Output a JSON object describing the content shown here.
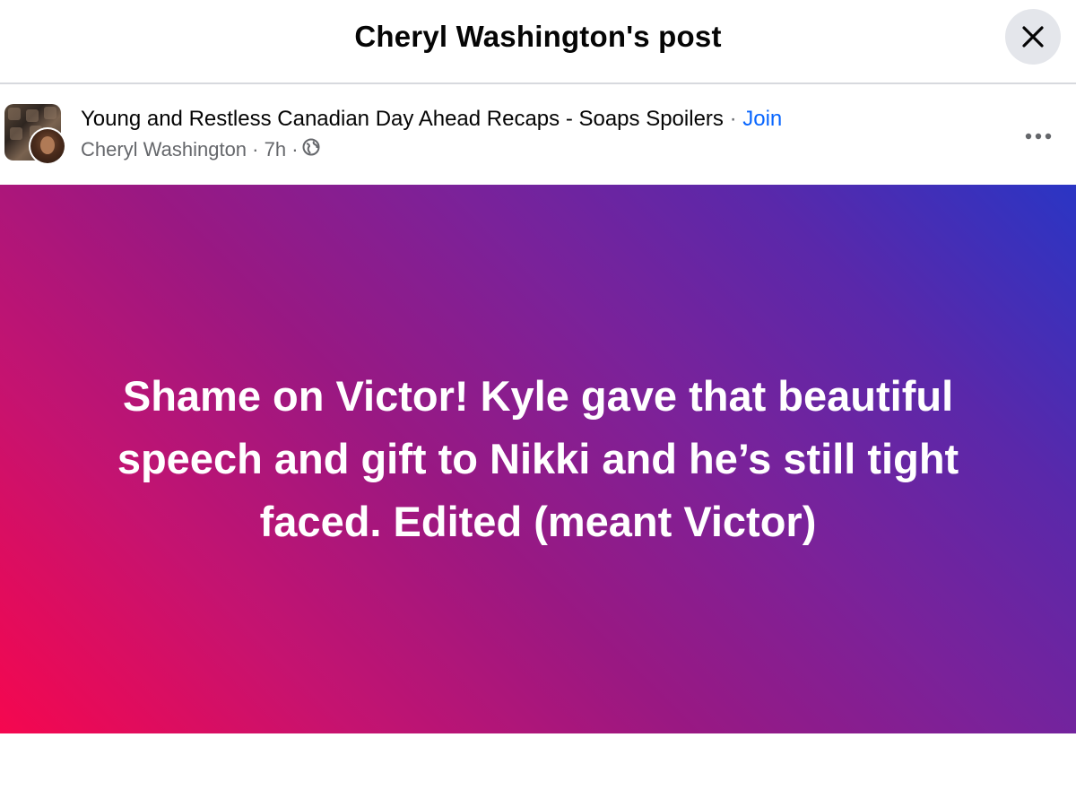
{
  "dialog": {
    "title": "Cheryl Washington's post",
    "close_icon": "close-icon"
  },
  "post": {
    "group_name": "Young and Restless Canadian Day Ahead Recaps - Soaps Spoilers",
    "separator": "·",
    "join_label": "Join",
    "author": "Cheryl Washington",
    "time": "7h",
    "audience_icon": "globe-icon",
    "more_icon": "more-horizontal-icon",
    "text": "Shame on Victor! Kyle gave that beautiful speech and gift to Nikki and he’s still tight faced. Edited (meant Victor)",
    "background_colors": [
      "#f5074f",
      "#9a1882",
      "#2a35c4"
    ]
  },
  "colors": {
    "link": "#0866ff",
    "secondary_text": "#65676b",
    "primary_text": "#050505"
  }
}
